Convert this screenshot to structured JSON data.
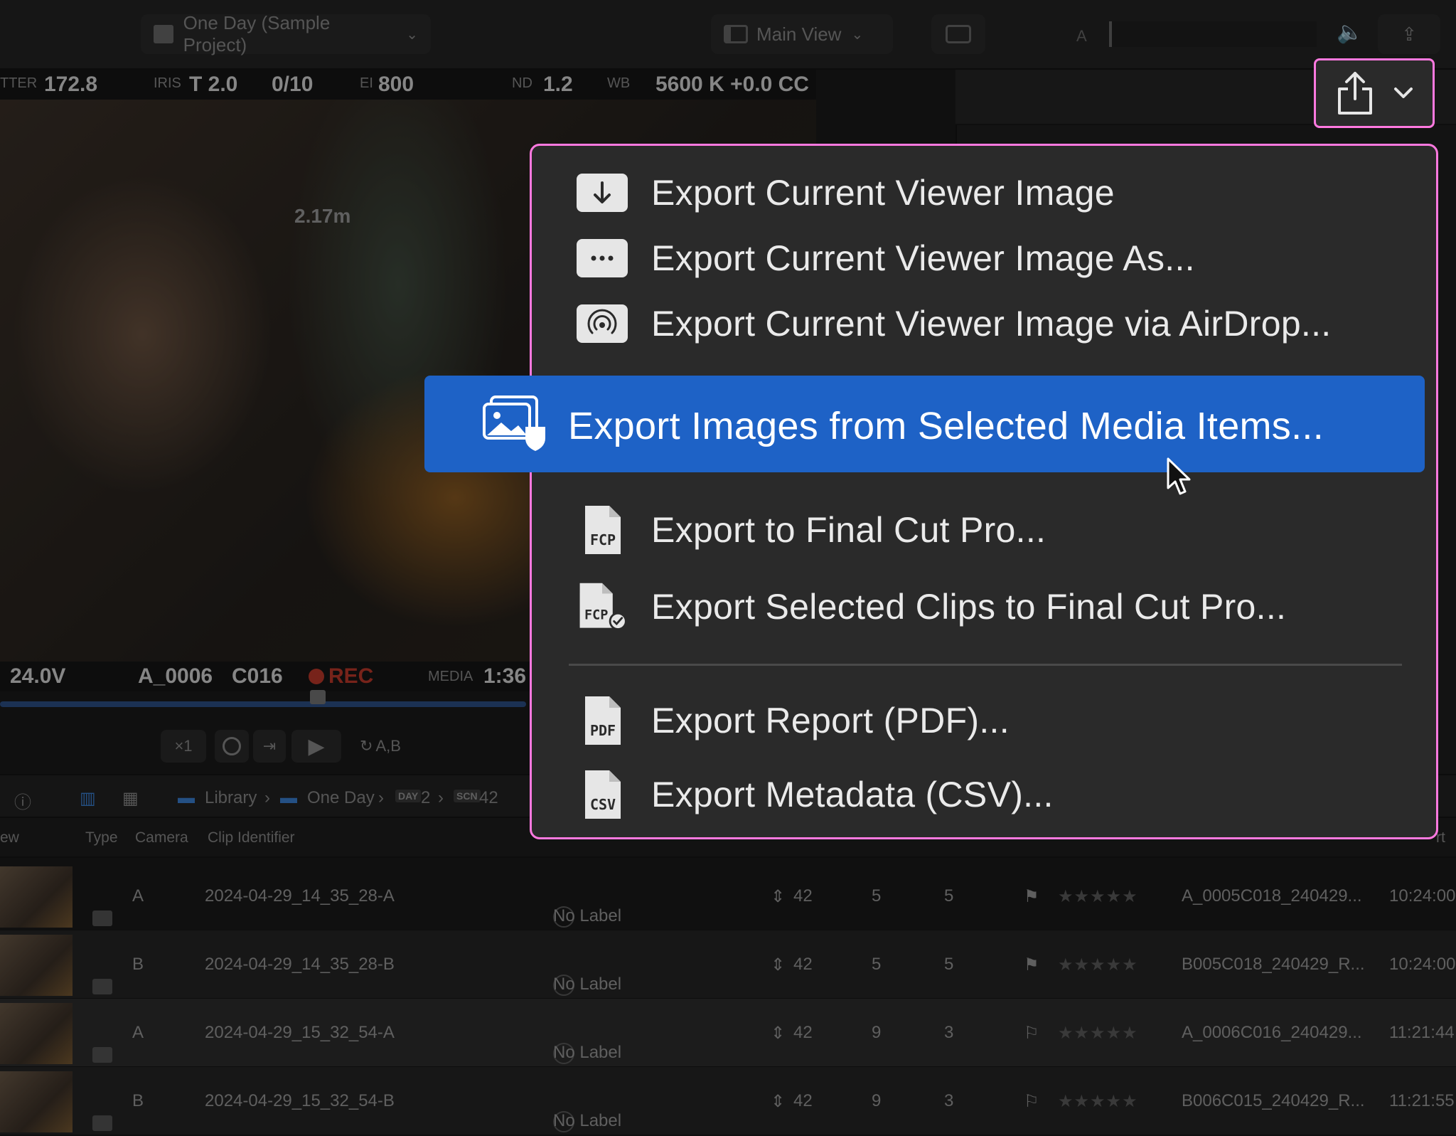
{
  "toolbar": {
    "project_label": "One Day (Sample Project)",
    "view_label": "Main View",
    "meter_label": "A"
  },
  "camera_overlay": {
    "shutter_label": "TTER",
    "shutter_value": "172.8",
    "iris_label": "IRIS",
    "iris_value": "T 2.0",
    "frame_value": "0/10",
    "ei_label": "EI",
    "ei_value": "800",
    "nd_label": "ND",
    "nd_value": "1.2",
    "wb_label": "WB",
    "wb_value": "5600 K +0.0 CC",
    "distance": "2.17m"
  },
  "timecode_strip": {
    "voltage": "24.0V",
    "reel": "A_0006",
    "clip": "C016",
    "rec": "REC",
    "media_label": "MEDIA",
    "media_value": "1:36"
  },
  "transport": {
    "speed": "×1",
    "angles": "A,B"
  },
  "breadcrumb": {
    "library": "Library",
    "project": "One Day",
    "day_badge": "DAY",
    "day": "2",
    "scene_badge": "SCN",
    "scene": "42"
  },
  "columns": {
    "view": "ew",
    "type": "Type",
    "camera": "Camera",
    "clip_identifier": "Clip Identifier",
    "right_tail": "rt"
  },
  "rows": [
    {
      "camera": "A",
      "clip_id": "2024-04-29_14_35_28-A",
      "label": "No Label",
      "scene": "42",
      "shot": "5",
      "take": "5",
      "rating": "★★★★★",
      "clip_name": "A_0005C018_240429...",
      "tc_start": "10:24:00"
    },
    {
      "camera": "B",
      "clip_id": "2024-04-29_14_35_28-B",
      "label": "No Label",
      "scene": "42",
      "shot": "5",
      "take": "5",
      "rating": "★★★★★",
      "clip_name": "B005C018_240429_R...",
      "tc_start": "10:24:00"
    },
    {
      "camera": "A",
      "clip_id": "2024-04-29_15_32_54-A",
      "label": "No Label",
      "scene": "42",
      "shot": "9",
      "take": "3",
      "rating": "★★★★★",
      "clip_name": "A_0006C016_240429...",
      "tc_start": "11:21:44"
    },
    {
      "camera": "B",
      "clip_id": "2024-04-29_15_32_54-B",
      "label": "No Label",
      "scene": "42",
      "shot": "9",
      "take": "3",
      "rating": "★★★★★",
      "clip_name": "B006C015_240429_R...",
      "tc_start": "11:21:55"
    }
  ],
  "menu": {
    "items": [
      {
        "label": "Export Current Viewer Image",
        "icon": "download-icon"
      },
      {
        "label": "Export Current Viewer Image As...",
        "icon": "more-icon"
      },
      {
        "label": "Export Current Viewer Image via AirDrop...",
        "icon": "airdrop-icon"
      },
      {
        "label": "Export Images from Selected Media Items...",
        "icon": "images-icon"
      },
      {
        "label": "Export to Final Cut Pro...",
        "icon": "fcp-file-icon",
        "badge": "FCP"
      },
      {
        "label": "Export Selected Clips to Final Cut Pro...",
        "icon": "fcp-check-file-icon",
        "badge": "FCP"
      },
      {
        "label": "Export Report (PDF)...",
        "icon": "pdf-file-icon",
        "badge": "PDF"
      },
      {
        "label": "Export Metadata (CSV)...",
        "icon": "csv-file-icon",
        "badge": "CSV"
      }
    ]
  },
  "colors": {
    "highlight": "#1e62c6",
    "annotation": "#ff79e0",
    "rec": "#c0392b"
  }
}
